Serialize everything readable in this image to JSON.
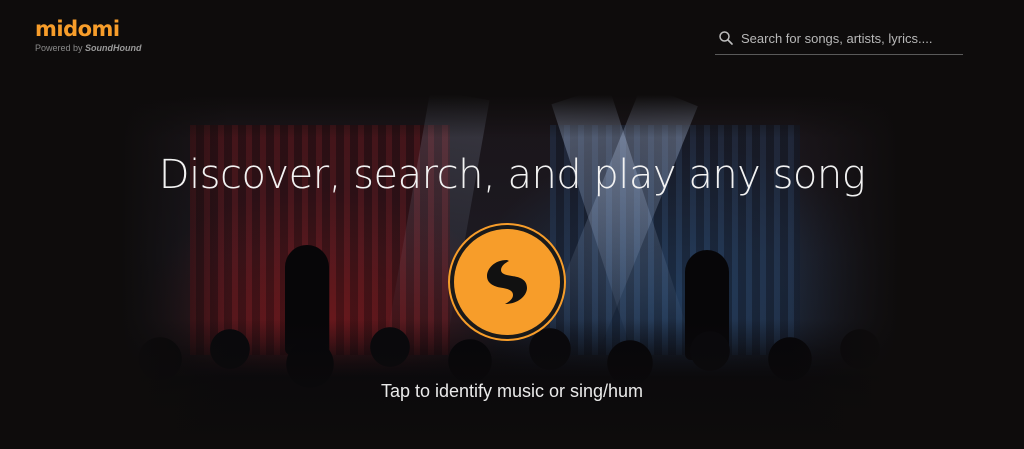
{
  "brand": {
    "logo_text": "midomi",
    "powered_by_prefix": "Powered by ",
    "powered_by_brand": "SoundHound",
    "accent_color": "#f79d2a"
  },
  "search": {
    "placeholder": "Search for songs, artists, lyrics....",
    "value": "",
    "icon": "search-icon"
  },
  "hero": {
    "headline": "Discover, search, and play any song",
    "identify_button_icon": "soundhound-logo-icon",
    "tap_prompt": "Tap to identify music or sing/hum"
  }
}
